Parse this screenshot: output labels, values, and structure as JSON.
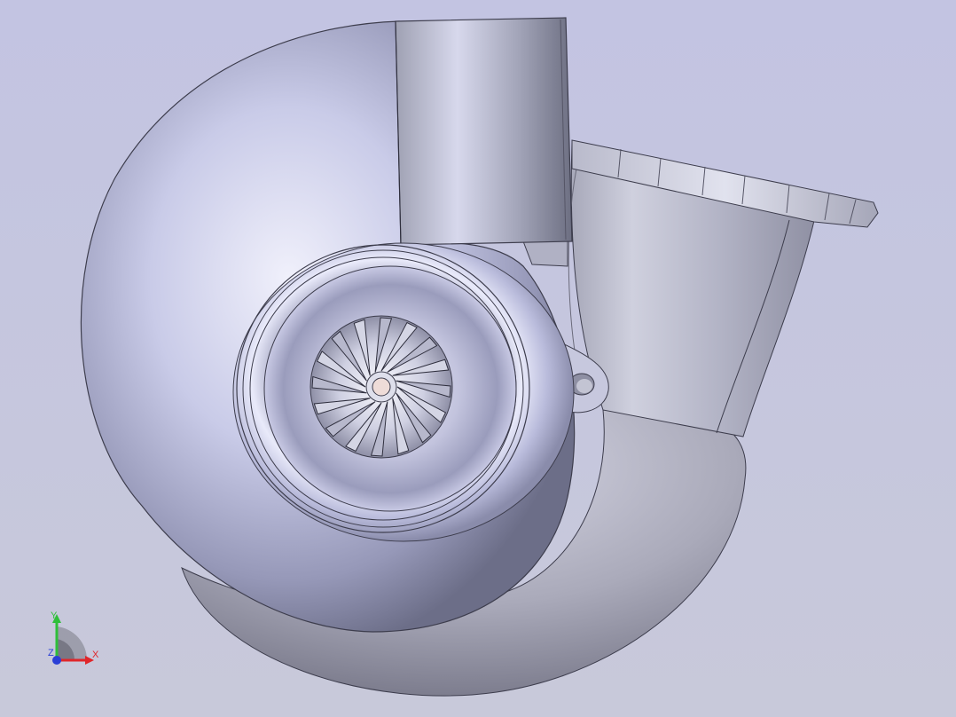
{
  "viewport": {
    "background_top": "#c3c4e2",
    "background_bottom": "#c8c9da",
    "model": "turbocharger-compressor-housing",
    "blade_count": 16
  },
  "triad": {
    "x_label": "X",
    "y_label": "Y",
    "z_label": "Z",
    "x_color": "#e0262a",
    "y_color": "#2fbf3a",
    "z_color": "#2a3fd6"
  }
}
